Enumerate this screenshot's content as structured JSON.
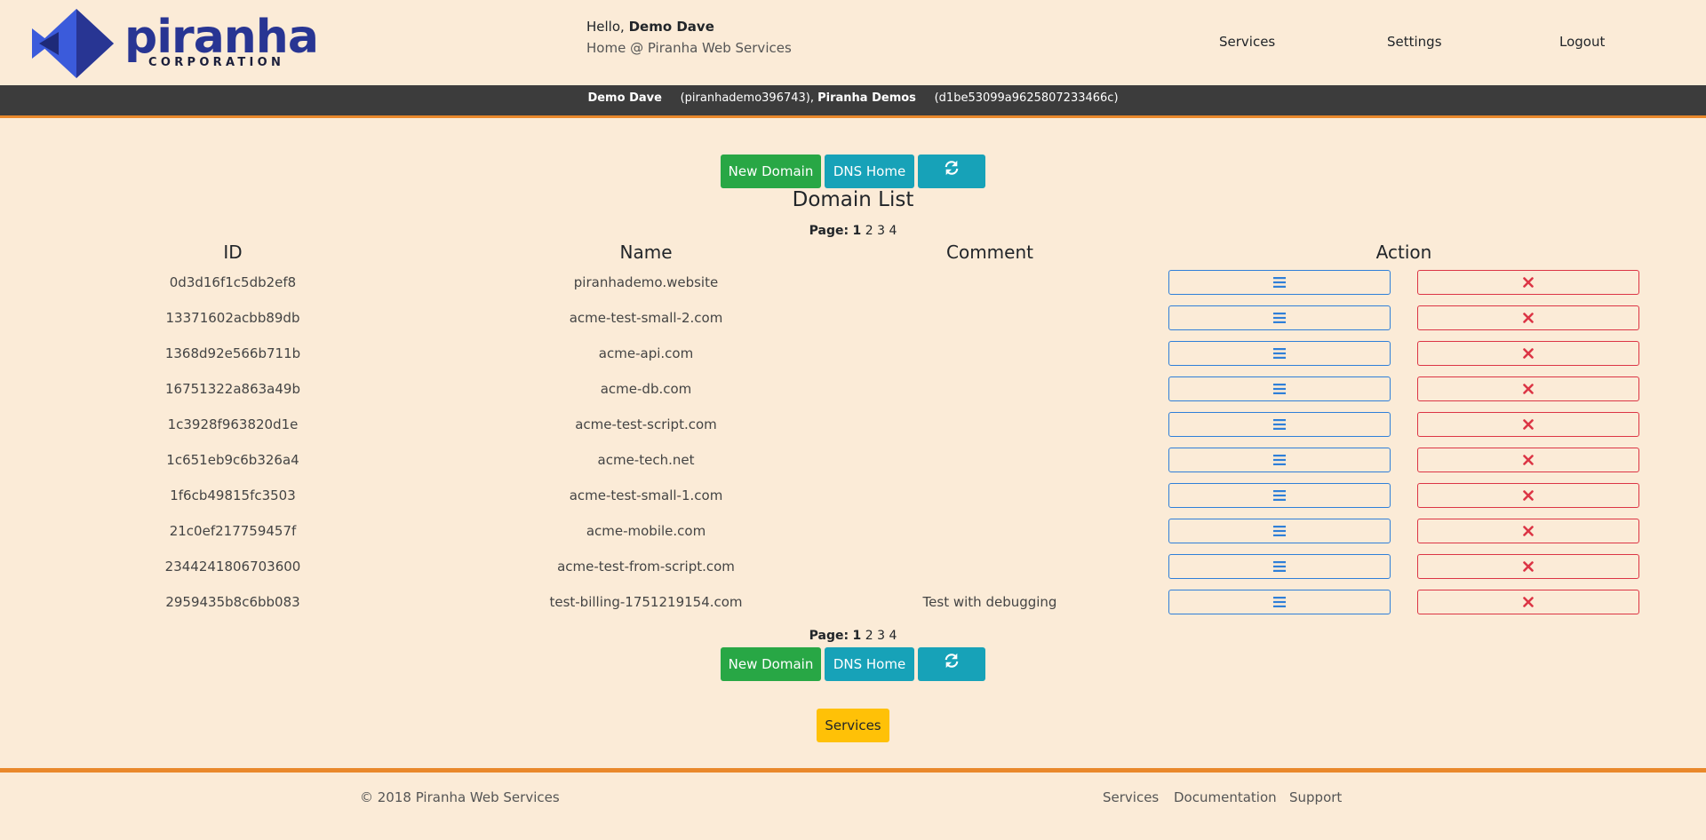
{
  "logo": {
    "word": "piranha",
    "sub": "CORPORATION"
  },
  "header": {
    "hello_prefix": "Hello,",
    "user_name": "Demo Dave",
    "home_label": "Home @ Piranha Web Services",
    "nav": {
      "services": "Services",
      "settings": "Settings",
      "logout": "Logout"
    }
  },
  "account": {
    "user": "Demo Dave",
    "user_id": "(piranhademo396743),",
    "org": "Piranha Demos",
    "org_id": "(d1be53099a9625807233466c)"
  },
  "toolbar": {
    "new_domain": "New Domain",
    "dns_home": "DNS Home",
    "refresh_icon": "refresh-icon"
  },
  "title": "Domain List",
  "pager": {
    "label": "Page:",
    "pages": [
      "1",
      "2",
      "3",
      "4"
    ],
    "current": "1"
  },
  "table": {
    "headers": {
      "id": "ID",
      "name": "Name",
      "comment": "Comment",
      "action": "Action"
    },
    "rows": [
      {
        "id": "0d3d16f1c5db2ef8",
        "name": "piranhademo.website",
        "comment": ""
      },
      {
        "id": "13371602acbb89db",
        "name": "acme-test-small-2.com",
        "comment": ""
      },
      {
        "id": "1368d92e566b711b",
        "name": "acme-api.com",
        "comment": ""
      },
      {
        "id": "16751322a863a49b",
        "name": "acme-db.com",
        "comment": ""
      },
      {
        "id": "1c3928f963820d1e",
        "name": "acme-test-script.com",
        "comment": ""
      },
      {
        "id": "1c651eb9c6b326a4",
        "name": "acme-tech.net",
        "comment": ""
      },
      {
        "id": "1f6cb49815fc3503",
        "name": "acme-test-small-1.com",
        "comment": ""
      },
      {
        "id": "21c0ef217759457f",
        "name": "acme-mobile.com",
        "comment": ""
      },
      {
        "id": "2344241806703600",
        "name": "acme-test-from-script.com",
        "comment": ""
      },
      {
        "id": "2959435b8c6bb083",
        "name": "test-billing-1751219154.com",
        "comment": "Test with debugging"
      }
    ]
  },
  "services_button": "Services",
  "footer": {
    "copyright": "© 2018 Piranha Web Services",
    "links": {
      "services": "Services",
      "documentation": "Documentation",
      "support": "Support"
    }
  },
  "colors": {
    "background": "#fbebd7",
    "accent": "#e9882b",
    "green": "#28a745",
    "teal": "#17a2b8",
    "yellow": "#ffc107",
    "logo_blue": "#283593"
  }
}
